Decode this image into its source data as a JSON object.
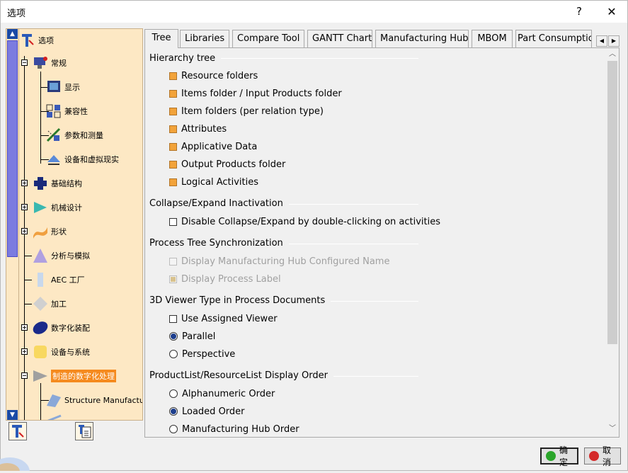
{
  "window": {
    "title": "选项",
    "help_label": "?",
    "close_label": "✕"
  },
  "tree": {
    "root": {
      "label": "选项",
      "icon": "options-root-icon"
    },
    "items": [
      {
        "label": "常规",
        "icon": "general-icon",
        "expander": "−"
      },
      {
        "label": "显示",
        "icon": "display-icon"
      },
      {
        "label": "兼容性",
        "icon": "compatibility-icon"
      },
      {
        "label": "参数和测量",
        "icon": "parameters-measure-icon"
      },
      {
        "label": "设备和虚拟现实",
        "icon": "devices-vr-icon"
      },
      {
        "label": "基础结构",
        "icon": "infrastructure-icon",
        "expander": "+"
      },
      {
        "label": "机械设计",
        "icon": "mechanical-design-icon",
        "expander": "+"
      },
      {
        "label": "形状",
        "icon": "shape-icon",
        "expander": "+"
      },
      {
        "label": "分析与模拟",
        "icon": "analysis-simulation-icon"
      },
      {
        "label": "AEC 工厂",
        "icon": "aec-plant-icon"
      },
      {
        "label": "加工",
        "icon": "machining-icon"
      },
      {
        "label": "数字化装配",
        "icon": "digital-mockup-icon",
        "expander": "+"
      },
      {
        "label": "设备与系统",
        "icon": "equipment-systems-icon",
        "expander": "+"
      },
      {
        "label": "制造的数字化处理",
        "icon": "digital-manufacturing-icon",
        "expander": "−",
        "selected": true
      },
      {
        "label": "Structure Manufactu",
        "icon": "structure-manufacturing-icon"
      }
    ],
    "scroll_up": "▲",
    "scroll_down": "▼"
  },
  "tabs": [
    {
      "label": "Tree",
      "active": true
    },
    {
      "label": "Libraries"
    },
    {
      "label": "Compare Tool"
    },
    {
      "label": "GANTT Chart"
    },
    {
      "label": "Manufacturing Hub"
    },
    {
      "label": "MBOM"
    },
    {
      "label": "Part Consumption"
    }
  ],
  "tab_scroll": {
    "left": "◀",
    "right": "▶"
  },
  "groups": {
    "hierarchy": {
      "title": "Hierarchy tree",
      "options": [
        "Resource folders",
        "Items folder / Input Products folder",
        "Item folders (per relation type)",
        "Attributes",
        "Applicative Data",
        "Output Products folder",
        "Logical Activities"
      ]
    },
    "collapse": {
      "title": "Collapse/Expand Inactivation",
      "options": [
        {
          "label": "Disable Collapse/Expand by double-clicking on activities",
          "checked": false
        }
      ]
    },
    "sync": {
      "title": "Process Tree Synchronization",
      "options": [
        {
          "label": "Display Manufacturing Hub Configured Name",
          "checked": false,
          "disabled": true
        },
        {
          "label": "Display Process Label",
          "checked": true,
          "disabled": true
        }
      ]
    },
    "viewer": {
      "title": "3D Viewer Type in Process Documents",
      "check": {
        "label": "Use Assigned Viewer",
        "checked": false
      },
      "radios": [
        {
          "label": "Parallel",
          "selected": true
        },
        {
          "label": "Perspective",
          "selected": false
        }
      ]
    },
    "order": {
      "title": "ProductList/ResourceList Display Order",
      "radios": [
        {
          "label": "Alphanumeric Order",
          "selected": false
        },
        {
          "label": "Loaded Order",
          "selected": true
        },
        {
          "label": "Manufacturing Hub Order",
          "selected": false
        }
      ]
    }
  },
  "scrollbar": {
    "up": "︿",
    "down": "﹀"
  },
  "buttons": {
    "ok": "确定",
    "cancel": "取消"
  },
  "colors": {
    "selected": "#f58a1e",
    "tree_bg": "#fde8c4",
    "ok_icon": "#2aa52a",
    "cancel_icon": "#d42a2a"
  }
}
